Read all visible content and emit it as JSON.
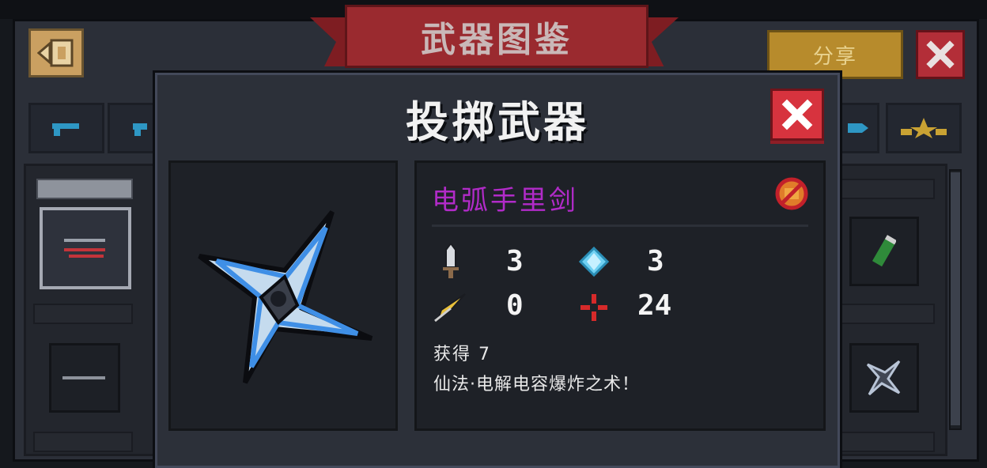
{
  "screen": {
    "banner_title": "武器图鉴",
    "share_label": "分享"
  },
  "modal": {
    "title": "投掷武器",
    "weapon": {
      "name": "电弧手里剑",
      "stats": {
        "damage": "3",
        "energy": "3",
        "crit": "0",
        "inaccuracy": "24"
      },
      "obtain": "获得 7",
      "description": "仙法·电解电容爆炸之术！"
    }
  },
  "colors": {
    "name_purple": "#b12bc8",
    "close_red": "#d7333e",
    "share_gold": "#b78b2c"
  },
  "icons": [
    "back-icon",
    "close-icon",
    "pistol-icon",
    "rifle-icon",
    "star-icon",
    "sword-icon",
    "diamond-icon",
    "feather-icon",
    "crosshair-icon",
    "shuriken-icon",
    "no-buy-icon"
  ]
}
